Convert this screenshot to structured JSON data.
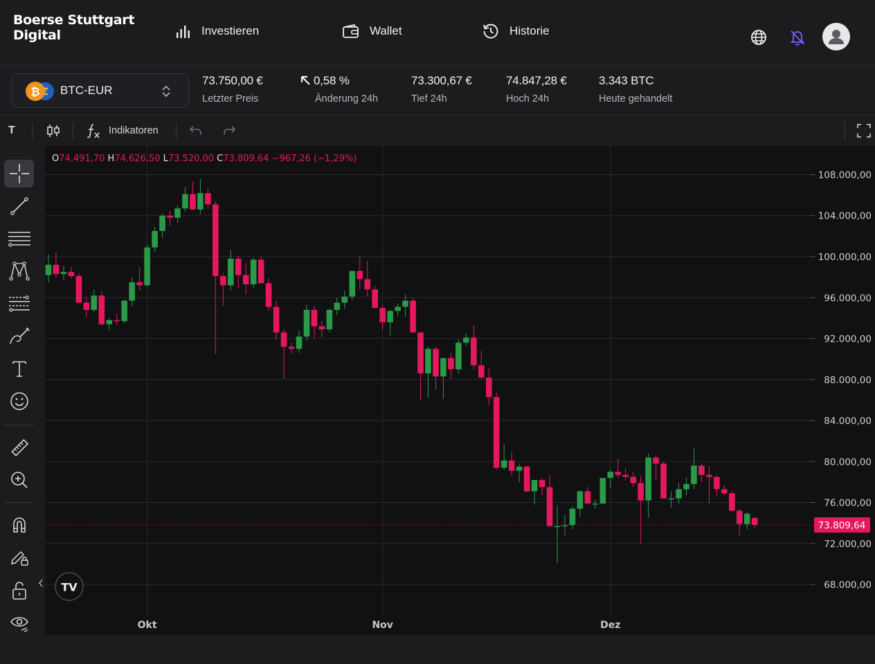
{
  "header": {
    "logo_line1": "Boerse Stuttgart",
    "logo_line2": "Digital",
    "nav": [
      {
        "label": "Investieren",
        "icon": "bar-chart-icon"
      },
      {
        "label": "Wallet",
        "icon": "wallet-icon"
      },
      {
        "label": "Historie",
        "icon": "history-icon"
      }
    ],
    "icons": [
      "globe-icon",
      "bell-off-icon",
      "user-avatar-icon"
    ]
  },
  "market": {
    "pair": "BTC-EUR",
    "stats": [
      {
        "value": "73.750,00 €",
        "label": "Letzter Preis"
      },
      {
        "value": "0,58 %",
        "label": "Änderung 24h"
      },
      {
        "value": "73.300,67 €",
        "label": "Tief 24h"
      },
      {
        "value": "74.847,28 €",
        "label": "Hoch 24h"
      },
      {
        "value": "3.343 BTC",
        "label": "Heute gehandelt"
      }
    ]
  },
  "toolbar": {
    "interval": "T",
    "indicators_label": "Indikatoren"
  },
  "ohlc": {
    "o_label": "O",
    "o": "74.491,70",
    "h_label": "H",
    "h": "74.626,50",
    "l_label": "L",
    "l": "73.520,00",
    "c_label": "C",
    "c": "73.809,64",
    "change": "−967,26 (−1,29%)"
  },
  "colors": {
    "up": "#2a9a48",
    "down": "#e5185d",
    "background": "#111113",
    "accent": "#7b61ff"
  },
  "chart_data": {
    "type": "candlestick",
    "x_ticks": [
      "Okt",
      "Nov",
      "Dez"
    ],
    "y_ticks": [
      "108.000,00",
      "104.000,00",
      "100.000,00",
      "96.000,00",
      "92.000,00",
      "88.000,00",
      "84.000,00",
      "80.000,00",
      "76.000,00",
      "72.000,00",
      "68.000,00"
    ],
    "y_tick_values": [
      108000,
      104000,
      100000,
      96000,
      92000,
      88000,
      84000,
      80000,
      76000,
      72000,
      68000
    ],
    "last_price_label": "73.809,64",
    "last_price": 73809.64,
    "ylim": [
      64900,
      110800
    ],
    "candles": [
      {
        "o": 98200,
        "h": 100200,
        "l": 97500,
        "c": 99200
      },
      {
        "o": 99200,
        "h": 100400,
        "l": 97900,
        "c": 98300
      },
      {
        "o": 98300,
        "h": 99100,
        "l": 97700,
        "c": 98500
      },
      {
        "o": 98500,
        "h": 99000,
        "l": 97900,
        "c": 98100
      },
      {
        "o": 98100,
        "h": 98400,
        "l": 95500,
        "c": 95500
      },
      {
        "o": 95500,
        "h": 96100,
        "l": 94100,
        "c": 94800
      },
      {
        "o": 94800,
        "h": 96800,
        "l": 94600,
        "c": 96200
      },
      {
        "o": 96200,
        "h": 96700,
        "l": 93300,
        "c": 93400
      },
      {
        "o": 93400,
        "h": 94000,
        "l": 92800,
        "c": 93800
      },
      {
        "o": 93800,
        "h": 94400,
        "l": 93300,
        "c": 93700
      },
      {
        "o": 93700,
        "h": 95800,
        "l": 93500,
        "c": 95700
      },
      {
        "o": 95700,
        "h": 98000,
        "l": 95200,
        "c": 97500
      },
      {
        "o": 97500,
        "h": 99000,
        "l": 96700,
        "c": 97200
      },
      {
        "o": 97200,
        "h": 101200,
        "l": 97000,
        "c": 100900
      },
      {
        "o": 100900,
        "h": 102900,
        "l": 100500,
        "c": 102500
      },
      {
        "o": 102500,
        "h": 104200,
        "l": 101800,
        "c": 104000
      },
      {
        "o": 104000,
        "h": 104500,
        "l": 103000,
        "c": 103800
      },
      {
        "o": 103800,
        "h": 105000,
        "l": 103300,
        "c": 104700
      },
      {
        "o": 104700,
        "h": 106800,
        "l": 104400,
        "c": 106100
      },
      {
        "o": 106100,
        "h": 107300,
        "l": 105200,
        "c": 104600
      },
      {
        "o": 104600,
        "h": 107600,
        "l": 104100,
        "c": 106200
      },
      {
        "o": 106200,
        "h": 106700,
        "l": 104700,
        "c": 105100
      },
      {
        "o": 105100,
        "h": 105400,
        "l": 90500,
        "c": 98100
      },
      {
        "o": 98100,
        "h": 98400,
        "l": 95200,
        "c": 97200
      },
      {
        "o": 97200,
        "h": 100700,
        "l": 96700,
        "c": 99800
      },
      {
        "o": 99800,
        "h": 100100,
        "l": 96900,
        "c": 98200
      },
      {
        "o": 98200,
        "h": 99300,
        "l": 96300,
        "c": 97300
      },
      {
        "o": 97300,
        "h": 99900,
        "l": 96900,
        "c": 99700
      },
      {
        "o": 99700,
        "h": 100000,
        "l": 97600,
        "c": 97400
      },
      {
        "o": 97400,
        "h": 97900,
        "l": 94700,
        "c": 95100
      },
      {
        "o": 95100,
        "h": 95700,
        "l": 91900,
        "c": 92600
      },
      {
        "o": 92600,
        "h": 92900,
        "l": 88100,
        "c": 91200
      },
      {
        "o": 91200,
        "h": 91600,
        "l": 90500,
        "c": 91000
      },
      {
        "o": 91000,
        "h": 92800,
        "l": 90600,
        "c": 92200
      },
      {
        "o": 92200,
        "h": 95300,
        "l": 91800,
        "c": 94800
      },
      {
        "o": 94800,
        "h": 95200,
        "l": 92000,
        "c": 93200
      },
      {
        "o": 93200,
        "h": 93700,
        "l": 92100,
        "c": 92900
      },
      {
        "o": 92900,
        "h": 94900,
        "l": 92600,
        "c": 94800
      },
      {
        "o": 94800,
        "h": 96000,
        "l": 94300,
        "c": 95500
      },
      {
        "o": 95500,
        "h": 96700,
        "l": 94900,
        "c": 96100
      },
      {
        "o": 96100,
        "h": 98500,
        "l": 95800,
        "c": 98600
      },
      {
        "o": 98600,
        "h": 100000,
        "l": 96800,
        "c": 97800
      },
      {
        "o": 97800,
        "h": 99600,
        "l": 96100,
        "c": 96800
      },
      {
        "o": 96800,
        "h": 97100,
        "l": 95000,
        "c": 95000
      },
      {
        "o": 95000,
        "h": 95300,
        "l": 92800,
        "c": 93600
      },
      {
        "o": 93600,
        "h": 94800,
        "l": 92300,
        "c": 94700
      },
      {
        "o": 94700,
        "h": 95400,
        "l": 94200,
        "c": 95100
      },
      {
        "o": 95100,
        "h": 96300,
        "l": 94100,
        "c": 95700
      },
      {
        "o": 95700,
        "h": 96000,
        "l": 92600,
        "c": 92600
      },
      {
        "o": 92600,
        "h": 92600,
        "l": 86000,
        "c": 88600
      },
      {
        "o": 88600,
        "h": 91200,
        "l": 86200,
        "c": 91000
      },
      {
        "o": 91000,
        "h": 91200,
        "l": 87000,
        "c": 88300
      },
      {
        "o": 88300,
        "h": 89800,
        "l": 86100,
        "c": 90100
      },
      {
        "o": 90100,
        "h": 90600,
        "l": 88100,
        "c": 89000
      },
      {
        "o": 89000,
        "h": 91900,
        "l": 88600,
        "c": 91600
      },
      {
        "o": 91600,
        "h": 92500,
        "l": 91300,
        "c": 92100
      },
      {
        "o": 92100,
        "h": 93300,
        "l": 89000,
        "c": 89400
      },
      {
        "o": 89400,
        "h": 90800,
        "l": 88100,
        "c": 88200
      },
      {
        "o": 88200,
        "h": 89100,
        "l": 85500,
        "c": 86300
      },
      {
        "o": 86300,
        "h": 86700,
        "l": 79200,
        "c": 79400
      },
      {
        "o": 79400,
        "h": 81700,
        "l": 79200,
        "c": 80100
      },
      {
        "o": 80100,
        "h": 81000,
        "l": 78600,
        "c": 79100
      },
      {
        "o": 79100,
        "h": 79800,
        "l": 78000,
        "c": 79500
      },
      {
        "o": 79500,
        "h": 79600,
        "l": 77000,
        "c": 77100
      },
      {
        "o": 77100,
        "h": 78100,
        "l": 75800,
        "c": 78200
      },
      {
        "o": 78200,
        "h": 78400,
        "l": 76700,
        "c": 77500
      },
      {
        "o": 77500,
        "h": 78700,
        "l": 73900,
        "c": 73700
      },
      {
        "o": 73700,
        "h": 75700,
        "l": 70100,
        "c": 73700
      },
      {
        "o": 73700,
        "h": 74800,
        "l": 72800,
        "c": 73800
      },
      {
        "o": 73800,
        "h": 75600,
        "l": 73400,
        "c": 75400
      },
      {
        "o": 75400,
        "h": 77200,
        "l": 74600,
        "c": 77100
      },
      {
        "o": 77100,
        "h": 77500,
        "l": 76300,
        "c": 75900
      },
      {
        "o": 75900,
        "h": 76300,
        "l": 75400,
        "c": 75900
      },
      {
        "o": 75900,
        "h": 78300,
        "l": 75900,
        "c": 78400
      },
      {
        "o": 78400,
        "h": 79200,
        "l": 77400,
        "c": 79000
      },
      {
        "o": 79000,
        "h": 80300,
        "l": 78400,
        "c": 78700
      },
      {
        "o": 78700,
        "h": 79400,
        "l": 78200,
        "c": 78500
      },
      {
        "o": 78500,
        "h": 79000,
        "l": 77500,
        "c": 77900
      },
      {
        "o": 77900,
        "h": 78600,
        "l": 72000,
        "c": 76200
      },
      {
        "o": 76200,
        "h": 80800,
        "l": 74500,
        "c": 80400
      },
      {
        "o": 80400,
        "h": 80600,
        "l": 78200,
        "c": 79800
      },
      {
        "o": 79800,
        "h": 80000,
        "l": 76400,
        "c": 76400
      },
      {
        "o": 76400,
        "h": 77100,
        "l": 75500,
        "c": 76400
      },
      {
        "o": 76400,
        "h": 77900,
        "l": 75900,
        "c": 77300
      },
      {
        "o": 77300,
        "h": 78400,
        "l": 76700,
        "c": 77800
      },
      {
        "o": 77800,
        "h": 81300,
        "l": 77300,
        "c": 79600
      },
      {
        "o": 79600,
        "h": 79800,
        "l": 78000,
        "c": 78700
      },
      {
        "o": 78700,
        "h": 79600,
        "l": 75900,
        "c": 78500
      },
      {
        "o": 78500,
        "h": 78600,
        "l": 76600,
        "c": 77300
      },
      {
        "o": 77300,
        "h": 77700,
        "l": 76700,
        "c": 76900
      },
      {
        "o": 76900,
        "h": 77100,
        "l": 75100,
        "c": 75200
      },
      {
        "o": 75200,
        "h": 75400,
        "l": 72800,
        "c": 73900
      },
      {
        "o": 73900,
        "h": 75100,
        "l": 73400,
        "c": 74900
      },
      {
        "o": 74492,
        "h": 74627,
        "l": 73520,
        "c": 73810
      }
    ]
  }
}
